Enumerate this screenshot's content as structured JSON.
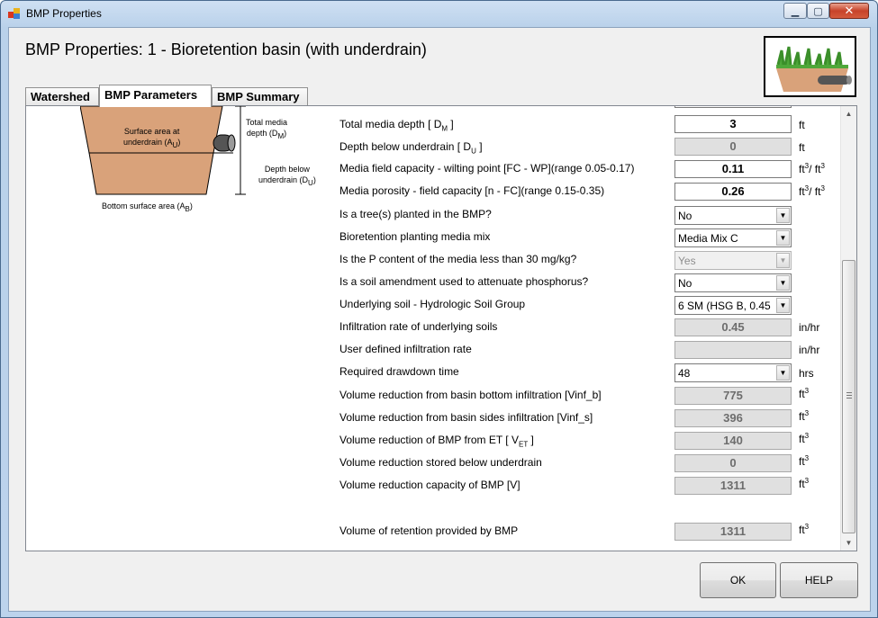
{
  "window": {
    "title": "BMP Properties"
  },
  "header": {
    "title": "BMP Properties: 1 - Bioretention basin (with underdrain)"
  },
  "tabs": [
    {
      "label": "Watershed"
    },
    {
      "label": "BMP Parameters"
    },
    {
      "label": "BMP Summary"
    }
  ],
  "diagram": {
    "surface_area_line1": "Surface area at",
    "surface_area_line2": "underdrain (A",
    "surface_area_sub": "U",
    "total_media_line1": "Total media",
    "total_media_line2": "depth (D",
    "total_media_sub": "M",
    "depth_below_line1": "Depth below",
    "depth_below_line2": "underdrain (D",
    "depth_below_sub": "U",
    "bottom_area": "Bottom surface area (A",
    "bottom_area_sub": "B"
  },
  "params": {
    "total_media_depth": {
      "label": "Total media depth [ D",
      "label_sub": "M",
      "label_end": " ]",
      "value": "3",
      "unit": "ft"
    },
    "depth_below_underdrain": {
      "label": "Depth below underdrain [ D",
      "label_sub": "U",
      "label_end": " ]",
      "value": "0",
      "unit": "ft"
    },
    "field_capacity": {
      "label": "Media field capacity - wilting point [FC - WP](range 0.05-0.17)",
      "value": "0.11",
      "unit": "ft",
      "unit_sup": "3",
      "unit_mid": "/ ft",
      "unit_sup2": "3"
    },
    "porosity": {
      "label": "Media porosity - field capacity [n - FC](range 0.15-0.35)",
      "value": "0.26",
      "unit": "ft",
      "unit_sup": "3",
      "unit_mid": "/ ft",
      "unit_sup2": "3"
    },
    "tree_planted": {
      "label": "Is a tree(s) planted in the BMP?",
      "value": "No"
    },
    "planting_media": {
      "label": "Bioretention planting media mix",
      "value": "Media Mix C"
    },
    "p_content": {
      "label": "Is the P content of the media less than 30 mg/kg?",
      "value": "Yes"
    },
    "soil_amendment": {
      "label": "Is a soil amendment used to attenuate phosphorus?",
      "value": "No"
    },
    "underlying_soil": {
      "label": "Underlying soil - Hydrologic Soil Group",
      "value": "6 SM (HSG B, 0.45"
    },
    "infiltration_rate": {
      "label": "Infiltration rate of underlying soils",
      "value": "0.45",
      "unit": "in/hr"
    },
    "user_infiltration": {
      "label": "User defined infiltration rate",
      "value": "",
      "unit": "in/hr"
    },
    "drawdown_time": {
      "label": "Required drawdown time",
      "value": "48",
      "unit": "hrs"
    },
    "vinf_b": {
      "label": "Volume reduction from basin bottom infiltration [Vinf_b]",
      "value": "775",
      "unit": "ft",
      "unit_sup": "3"
    },
    "vinf_s": {
      "label": "Volume reduction from basin sides infiltration [Vinf_s]",
      "value": "396",
      "unit": "ft",
      "unit_sup": "3"
    },
    "vet": {
      "label": "Volume reduction of BMP from ET [ V",
      "label_sub": "ET",
      "label_end": " ]",
      "value": "140",
      "unit": "ft",
      "unit_sup": "3"
    },
    "stored_below": {
      "label": "Volume reduction stored below underdrain",
      "value": "0",
      "unit": "ft",
      "unit_sup": "3"
    },
    "capacity": {
      "label": "Volume reduction capacity of BMP [V]",
      "value": "1311",
      "unit": "ft",
      "unit_sup": "3"
    },
    "retention": {
      "label": "Volume of retention provided by BMP",
      "value": "1311",
      "unit": "ft",
      "unit_sup": "3"
    }
  },
  "buttons": {
    "ok": "OK",
    "help": "HELP"
  },
  "colors": {
    "media_fill": "#d9a27a",
    "grass": "#4fa83a",
    "pipe": "#555555"
  },
  "icons": [
    "app-icon",
    "minimize-icon",
    "maximize-icon",
    "close-icon",
    "scroll-up-icon",
    "scroll-down-icon",
    "dropdown-arrow-icon"
  ]
}
